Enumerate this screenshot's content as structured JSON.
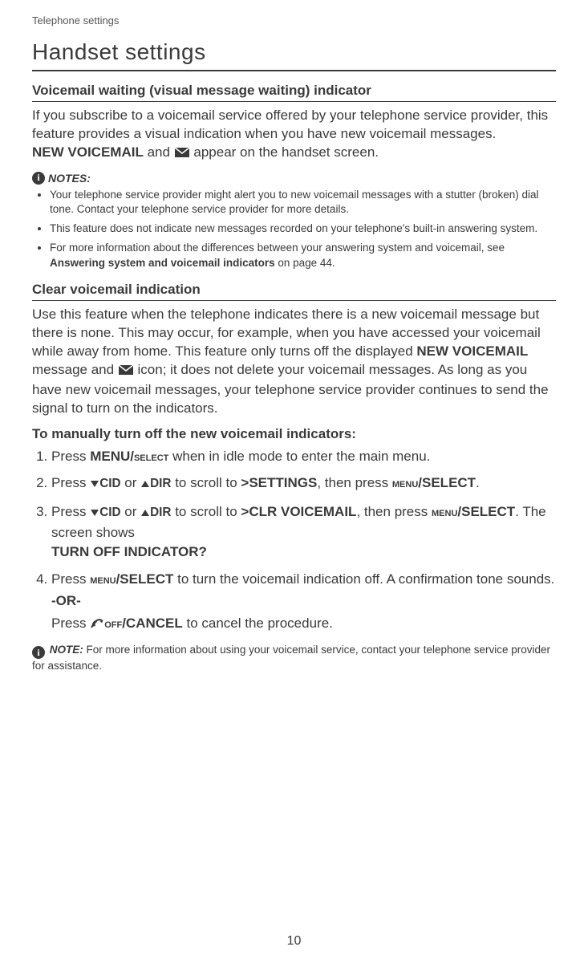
{
  "runningHead": "Telephone settings",
  "chapterTitle": "Handset settings",
  "section1": {
    "title": "Voicemail waiting (visual message waiting) indicator",
    "para_pre": "If you subscribe to a voicemail service offered by your telephone service provider, this feature provides a visual indication when you have new voicemail messages.",
    "para_new_vm": "NEW VOICEMAIL",
    "para_post": " and ",
    "para_tail": " appear on the handset screen."
  },
  "notesLabel": "NOTES:",
  "notes": [
    "Your telephone service provider might alert you to new voicemail messages with a stutter (broken) dial tone. Contact your telephone service provider for more details.",
    "This feature does not indicate new messages recorded on your telephone's built-in answering system.",
    {
      "pre": "For more information about the differences between your answering system and voicemail, see ",
      "bold": "Answering system and voicemail indicators",
      "post": " on page 44."
    }
  ],
  "section2": {
    "title": "Clear voicemail indication",
    "para_pre": "Use this feature when the telephone indicates there is a new voicemail message but there is none. This may occur, for example, when you have accessed your voicemail while away from home. This feature only turns off the displayed ",
    "para_bold1": "NEW VOICEMAIL",
    "para_mid": " message and ",
    "para_tail": " icon; it does not delete your voicemail messages. As long as you have new voicemail messages, your telephone service provider continues to send the signal to turn on the indicators."
  },
  "procTitle": "To manually turn off the new voicemail indicators:",
  "steps": {
    "s1_pre": "Press ",
    "s1_key": "MENU/",
    "s1_key_sc": "select",
    "s1_post": " when in idle mode to enter the main menu.",
    "s2_pre": "Press ",
    "s2_cid": "CID",
    "s2_or": " or ",
    "s2_dir": "DIR",
    "s2_mid": " to scroll to ",
    "s2_target": ">SETTINGS",
    "s2_then": ", then press ",
    "s2_menu_sc": "menu",
    "s2_select": "/SELECT",
    "s2_end": ".",
    "s3_target": ">CLR VOICEMAIL",
    "s3_then": ", then press ",
    "s3_menu_sc": "menu",
    "s3_select": "/SELECT",
    "s3_tail": ". The screen shows ",
    "s3_prompt": "TURN OFF INDICATOR?",
    "s4_pre": "Press ",
    "s4_menu_sc": "menu",
    "s4_select": "/SELECT",
    "s4_mid": " to turn the voicemail indication off. A confirmation tone sounds.",
    "s4_or": "-OR-",
    "s4_press": "Press ",
    "s4_off_sc": "off",
    "s4_cancel": "/CANCEL",
    "s4_tail": " to cancel the procedure."
  },
  "noteLabel": "NOTE:",
  "footerNote": " For more information about using your voicemail service, contact your telephone service provider for assistance.",
  "pageNumber": "10"
}
